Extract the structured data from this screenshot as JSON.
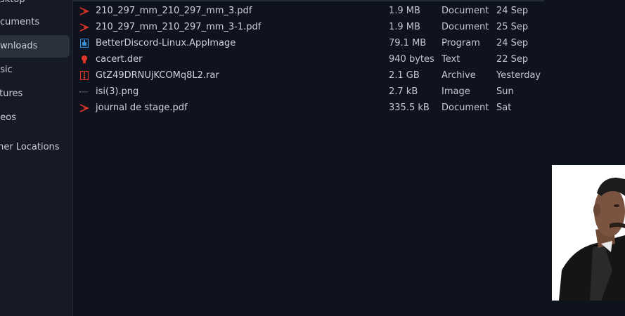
{
  "sidebar": {
    "items": [
      {
        "label": "esktop",
        "icon": "desktop-icon"
      },
      {
        "label": "ocuments",
        "icon": "documents-icon"
      },
      {
        "label": "ownloads",
        "icon": "downloads-icon",
        "active": true
      },
      {
        "label": "usic",
        "icon": "music-icon"
      },
      {
        "label": "ctures",
        "icon": "pictures-icon"
      },
      {
        "label": "deos",
        "icon": "videos-icon"
      },
      {
        "label": "ther Locations",
        "icon": "other-locations-icon"
      }
    ]
  },
  "files": [
    {
      "name": "210_297_mm_210_297_mm_3.pdf",
      "size": "1.9 MB",
      "type": "Document",
      "date": "24 Sep",
      "icon": "pdf-icon"
    },
    {
      "name": "210_297_mm_210_297_mm_3-1.pdf",
      "size": "1.9 MB",
      "type": "Document",
      "date": "25 Sep",
      "icon": "pdf-icon"
    },
    {
      "name": "BetterDiscord-Linux.AppImage",
      "size": "79.1 MB",
      "type": "Program",
      "date": "24 Sep",
      "icon": "appimage-icon"
    },
    {
      "name": "cacert.der",
      "size": "940 bytes",
      "type": "Text",
      "date": "22 Sep",
      "icon": "certificate-icon"
    },
    {
      "name": "GtZ49DRNUjKCOMq8L2.rar",
      "size": "2.1 GB",
      "type": "Archive",
      "date": "Yesterday",
      "icon": "archive-icon"
    },
    {
      "name": "isi(3).png",
      "size": "2.7 kB",
      "type": "Image",
      "date": "Sun",
      "icon": "image-icon"
    },
    {
      "name": "journal de stage.pdf",
      "size": "335.5 kB",
      "type": "Document",
      "date": "Sat",
      "icon": "pdf-icon"
    }
  ],
  "colors": {
    "pdf_icon": "#e0352b",
    "appimage_icon": "#3a8fd9",
    "cert_icon": "#e0352b",
    "archive_icon": "#e0352b",
    "sidebar_active": "#2b303d"
  },
  "overlay": {
    "icon": "person-photo"
  }
}
